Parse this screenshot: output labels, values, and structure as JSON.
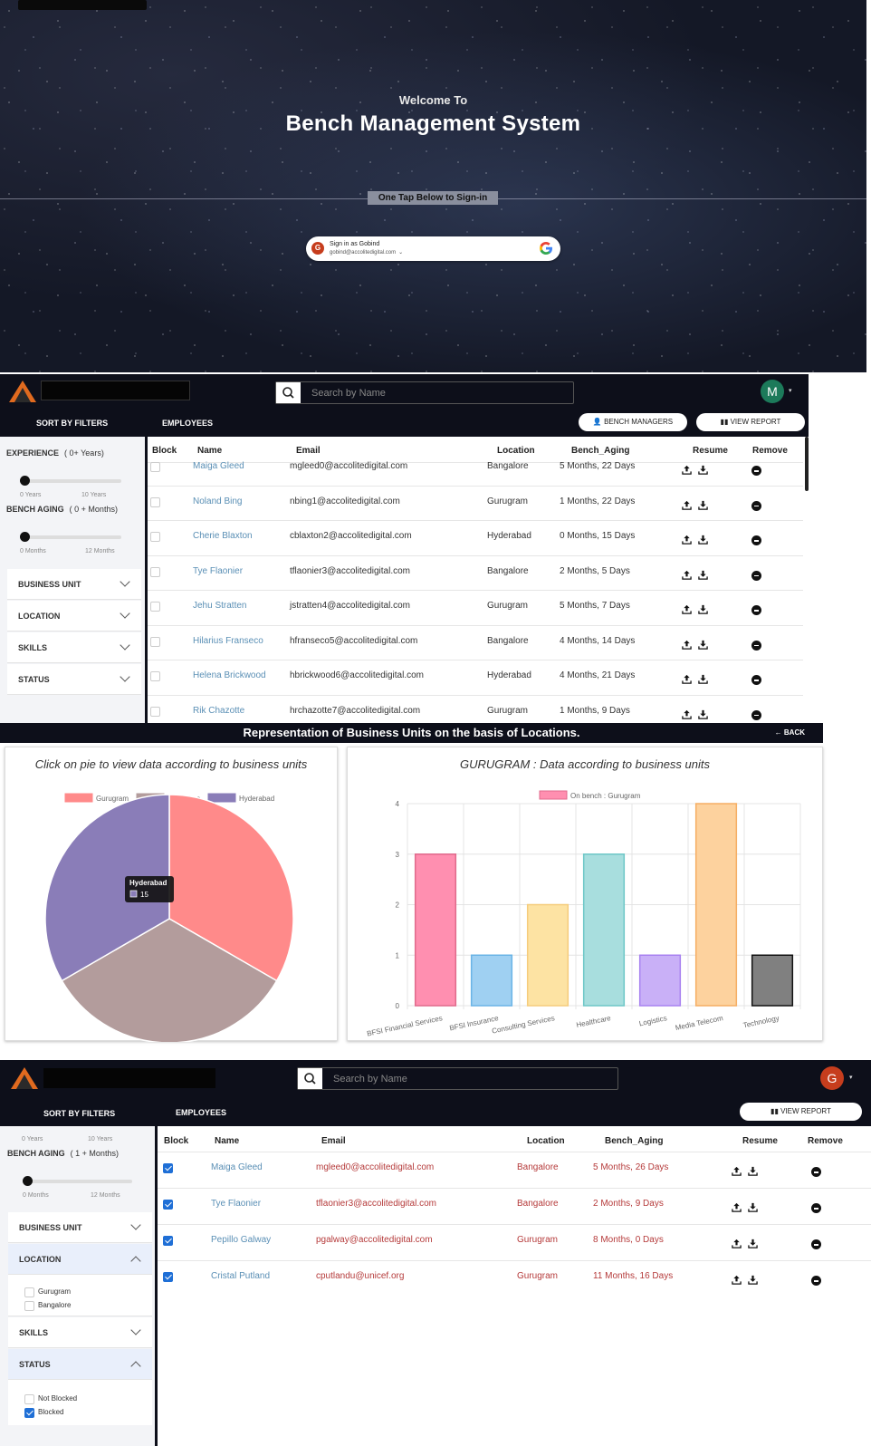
{
  "login": {
    "welcome": "Welcome To",
    "title": "Bench Management System",
    "one_tap": "One Tap Below to Sign-in",
    "sign_in_name": "Sign in as Gobind",
    "sign_in_email": "gobind@accolitedigital.com",
    "avatar_letter": "G"
  },
  "screen1": {
    "search_placeholder": "Search by Name",
    "avatar_letter": "M",
    "avatar_color": "#1c7a5a",
    "sort_title": "SORT BY FILTERS",
    "employees_title": "EMPLOYEES",
    "bench_managers_label": "BENCH MANAGERS",
    "view_report_label": "VIEW REPORT",
    "experience_label": "EXPERIENCE",
    "experience_range": "( 0+ Years)",
    "exp_min": "0 Years",
    "exp_max": "10 Years",
    "aging_label": "BENCH AGING",
    "aging_range": "( 0 + Months)",
    "aging_min": "0 Months",
    "aging_max": "12 Months",
    "filters": [
      "BUSINESS UNIT",
      "LOCATION",
      "SKILLS",
      "STATUS"
    ],
    "columns": [
      "Block",
      "Name",
      "Email",
      "Location",
      "Bench_Aging",
      "Resume",
      "Remove"
    ],
    "rows": [
      {
        "name": "Maiga Gleed",
        "email": "mgleed0@accolitedigital.com",
        "location": "Bangalore",
        "aging": "5 Months, 22 Days"
      },
      {
        "name": "Noland Bing",
        "email": "nbing1@accolitedigital.com",
        "location": "Gurugram",
        "aging": "1 Months, 22 Days"
      },
      {
        "name": "Cherie Blaxton",
        "email": "cblaxton2@accolitedigital.com",
        "location": "Hyderabad",
        "aging": "0 Months, 15 Days"
      },
      {
        "name": "Tye Flaonier",
        "email": "tflaonier3@accolitedigital.com",
        "location": "Bangalore",
        "aging": "2 Months, 5 Days"
      },
      {
        "name": "Jehu Stratten",
        "email": "jstratten4@accolitedigital.com",
        "location": "Gurugram",
        "aging": "5 Months, 7 Days"
      },
      {
        "name": "Hilarius Franseco",
        "email": "hfranseco5@accolitedigital.com",
        "location": "Bangalore",
        "aging": "4 Months, 14 Days"
      },
      {
        "name": "Helena Brickwood",
        "email": "hbrickwood6@accolitedigital.com",
        "location": "Hyderabad",
        "aging": "4 Months, 21 Days"
      },
      {
        "name": "Rik Chazotte",
        "email": "hrchazotte7@accolitedigital.com",
        "location": "Gurugram",
        "aging": "1 Months, 9 Days"
      }
    ]
  },
  "charts": {
    "header": "Representation of Business Units on the basis of Locations.",
    "back": "BACK",
    "pie_title": "Click on pie to view data according to business units",
    "bar_title": "GURUGRAM : Data according to business units",
    "tooltip_label": "Hyderabad",
    "tooltip_value": "15"
  },
  "chart_data": [
    {
      "type": "pie",
      "title": "Click on pie to view data according to business units",
      "categories": [
        "Gurugram",
        "Bangalore",
        "Hyderabad"
      ],
      "values": [
        15,
        15,
        15
      ],
      "colors": [
        "#ff8a8a",
        "#b39c9c",
        "#8a7db8"
      ],
      "legend": "top"
    },
    {
      "type": "bar",
      "title": "GURUGRAM : Data according to business units",
      "series": [
        {
          "name": "On bench : Gurugram",
          "values": [
            3,
            1,
            2,
            3,
            1,
            4,
            1
          ]
        }
      ],
      "categories": [
        "BFSI Financial Services",
        "BFSI Insurance",
        "Consulting Services",
        "Healthcare",
        "Logistics",
        "Media Telecom",
        "Technology"
      ],
      "colors": [
        "#ff8fb0",
        "#9fd0f2",
        "#fde3a3",
        "#a8dede",
        "#c9b0f7",
        "#fdd29e",
        "#808080"
      ],
      "borders": [
        "#e06a8c",
        "#6ab4e6",
        "#f5cc7c",
        "#6ec7c7",
        "#a882f0",
        "#f5ae64",
        "#111111"
      ],
      "ylim": [
        0,
        4
      ],
      "yticks": [
        0,
        1,
        2,
        3,
        4
      ],
      "grid": true,
      "legend": "top"
    }
  ],
  "screen2": {
    "search_placeholder": "Search by Name",
    "avatar_letter": "G",
    "avatar_color": "#c63d1d",
    "sort_title": "SORT BY FILTERS",
    "employees_title": "EMPLOYEES",
    "view_report_label": "VIEW REPORT",
    "exp_min": "0 Years",
    "exp_max": "10 Years",
    "aging_label": "BENCH AGING",
    "aging_range": "( 1 + Months)",
    "aging_min": "0 Months",
    "aging_max": "12 Months",
    "filter_business": "BUSINESS UNIT",
    "filter_location": "LOCATION",
    "location_options": [
      "Gurugram",
      "Bangalore"
    ],
    "filter_skills": "SKILLS",
    "filter_status": "STATUS",
    "status_options": [
      "Not Blocked",
      "Blocked"
    ],
    "columns": [
      "Block",
      "Name",
      "Email",
      "Location",
      "Bench_Aging",
      "Resume",
      "Remove"
    ],
    "rows": [
      {
        "name": "Maiga Gleed",
        "email": "mgleed0@accolitedigital.com",
        "location": "Bangalore",
        "aging": "5 Months, 26 Days"
      },
      {
        "name": "Tye Flaonier",
        "email": "tflaonier3@accolitedigital.com",
        "location": "Bangalore",
        "aging": "2 Months, 9 Days"
      },
      {
        "name": "Pepillo Galway",
        "email": "pgalway@accolitedigital.com",
        "location": "Gurugram",
        "aging": "8 Months, 0 Days"
      },
      {
        "name": "Cristal Putland",
        "email": "cputlandu@unicef.org",
        "location": "Gurugram",
        "aging": "11 Months, 16 Days"
      }
    ]
  }
}
